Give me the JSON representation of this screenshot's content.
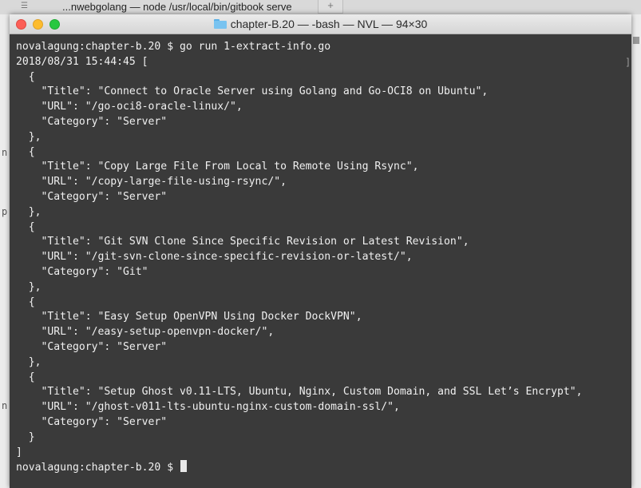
{
  "background_window": {
    "tab_text": "...nwebgolang — node /usr/local/bin/gitbook serve",
    "new_tab_label": "+",
    "edge_chars": [
      "n",
      "p",
      "n"
    ]
  },
  "terminal": {
    "title": "chapter-B.20 — -bash — NVL — 94×30",
    "lines": [
      "novalagung:chapter-b.20 $ go run 1-extract-info.go",
      "2018/08/31 15:44:45 [",
      "  {",
      "    \"Title\": \"Connect to Oracle Server using Golang and Go-OCI8 on Ubuntu\",",
      "    \"URL\": \"/go-oci8-oracle-linux/\",",
      "    \"Category\": \"Server\"",
      "  },",
      "  {",
      "    \"Title\": \"Copy Large File From Local to Remote Using Rsync\",",
      "    \"URL\": \"/copy-large-file-using-rsync/\",",
      "    \"Category\": \"Server\"",
      "  },",
      "  {",
      "    \"Title\": \"Git SVN Clone Since Specific Revision or Latest Revision\",",
      "    \"URL\": \"/git-svn-clone-since-specific-revision-or-latest/\",",
      "    \"Category\": \"Git\"",
      "  },",
      "  {",
      "    \"Title\": \"Easy Setup OpenVPN Using Docker DockVPN\",",
      "    \"URL\": \"/easy-setup-openvpn-docker/\",",
      "    \"Category\": \"Server\"",
      "  },",
      "  {",
      "    \"Title\": \"Setup Ghost v0.11-LTS, Ubuntu, Nginx, Custom Domain, and SSL Let’s Encrypt\",",
      "    \"URL\": \"/ghost-v011-lts-ubuntu-nginx-custom-domain-ssl/\",",
      "    \"Category\": \"Server\"",
      "  }",
      "]",
      "novalagung:chapter-b.20 $ "
    ]
  },
  "colors": {
    "terminal_bg": "#3a3a3a",
    "terminal_fg": "#f0f0f0",
    "close": "#fc5f57",
    "minimize": "#fdbc2e",
    "maximize": "#28c840"
  },
  "icons": {
    "title_icon": "folder-icon",
    "bg_tab_icon": "terminal-tab-icon"
  }
}
